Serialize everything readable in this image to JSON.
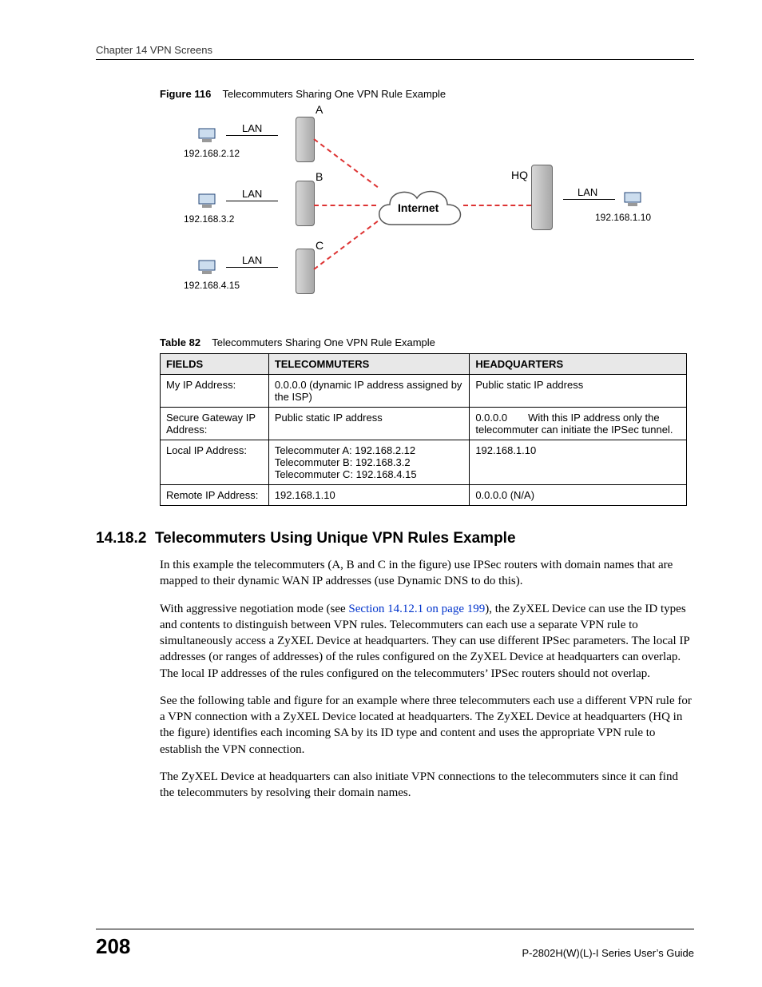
{
  "header": {
    "chapter": "Chapter 14 VPN Screens"
  },
  "figure": {
    "label": "Figure 116",
    "title": "Telecommuters Sharing One VPN Rule Example",
    "nodes": {
      "a": "A",
      "b": "B",
      "c": "C",
      "hq": "HQ",
      "lan": "LAN",
      "internet": "Internet"
    },
    "ips": {
      "a": "192.168.2.12",
      "b": "192.168.3.2",
      "c": "192.168.4.15",
      "hq": "192.168.1.10"
    }
  },
  "table": {
    "label": "Table 82",
    "title": "Telecommuters Sharing One VPN Rule Example",
    "headers": {
      "c1": "FIELDS",
      "c2": "TELECOMMUTERS",
      "c3": "HEADQUARTERS"
    },
    "rows": [
      {
        "field": "My IP Address:",
        "tele": "0.0.0.0 (dynamic IP address assigned by the ISP)",
        "hq": "Public static IP address"
      },
      {
        "field": "Secure Gateway IP Address:",
        "tele": "Public static IP address",
        "hq": "0.0.0.0  With this IP address only the telecommuter can initiate the IPSec tunnel."
      },
      {
        "field": "Local IP Address:",
        "tele": "Telecommuter A: 192.168.2.12\nTelecommuter B: 192.168.3.2\nTelecommuter C: 192.168.4.15",
        "hq": "192.168.1.10"
      },
      {
        "field": "Remote IP Address:",
        "tele": "192.168.1.10",
        "hq": "0.0.0.0 (N/A)"
      }
    ]
  },
  "section": {
    "num": "14.18.2",
    "title": "Telecommuters Using Unique VPN Rules Example",
    "p1": "In this example the telecommuters (A, B and C in the figure) use IPSec routers with domain names that are mapped to their dynamic WAN IP addresses (use Dynamic DNS to do this).",
    "p2a": "With aggressive negotiation mode (see ",
    "p2link": "Section 14.12.1 on page 199",
    "p2b": "), the ZyXEL Device can use the ID types and contents to distinguish between VPN rules. Telecommuters can each use a separate VPN rule to simultaneously access a ZyXEL Device at headquarters. They can use different IPSec parameters. The local IP addresses (or ranges of addresses) of the rules configured on the ZyXEL Device at headquarters can overlap. The local IP addresses of the rules configured on the telecommuters’ IPSec routers should not overlap.",
    "p3": "See the following table and figure for an example where three telecommuters each use a different VPN rule for a VPN connection with a ZyXEL Device located at headquarters. The ZyXEL Device at headquarters (HQ in the figure) identifies each incoming SA by its ID type and content and uses the appropriate VPN rule to establish the VPN connection.",
    "p4": "The ZyXEL Device at headquarters can also initiate VPN connections to the telecommuters since it can find the telecommuters by resolving their domain names."
  },
  "footer": {
    "page": "208",
    "guide": "P-2802H(W)(L)-I Series User’s Guide"
  }
}
